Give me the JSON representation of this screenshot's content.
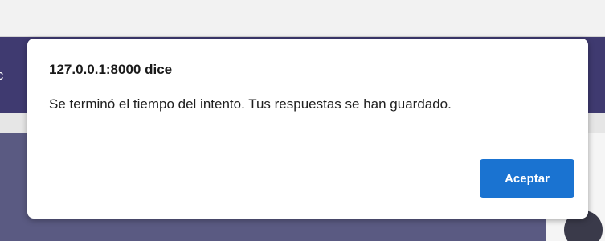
{
  "background": {
    "header_fragment": "ic"
  },
  "dialog": {
    "title": "127.0.0.1:8000 dice",
    "message": "Se terminó el tiempo del intento. Tus respuestas se han guardado.",
    "ok_label": "Aceptar"
  },
  "colors": {
    "header": "#3f3a70",
    "button": "#1a73d1",
    "dialog_bg": "#ffffff"
  }
}
